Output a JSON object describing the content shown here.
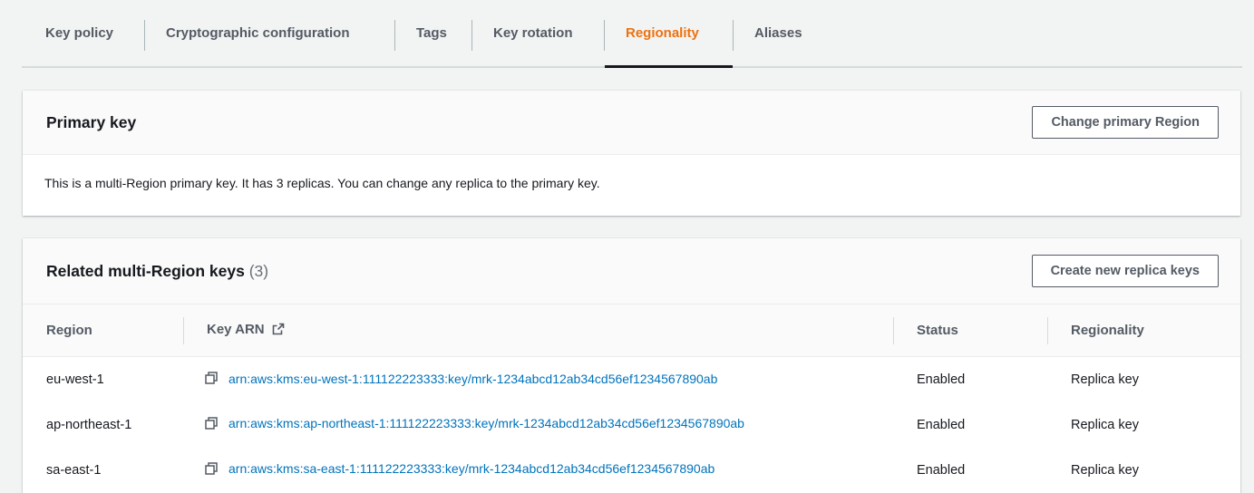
{
  "tabs": [
    {
      "label": "Key policy",
      "active": false
    },
    {
      "label": "Cryptographic configuration",
      "active": false
    },
    {
      "label": "Tags",
      "active": false
    },
    {
      "label": "Key rotation",
      "active": false
    },
    {
      "label": "Regionality",
      "active": true
    },
    {
      "label": "Aliases",
      "active": false
    }
  ],
  "primary_key": {
    "title": "Primary key",
    "button_label": "Change primary Region",
    "description": "This is a multi-Region primary key. It has 3 replicas. You can change any replica to the primary key."
  },
  "related_keys": {
    "title": "Related multi-Region keys",
    "count": "(3)",
    "button_label": "Create new replica keys",
    "columns": {
      "region": "Region",
      "key_arn": "Key ARN",
      "status": "Status",
      "regionality": "Regionality"
    },
    "rows": [
      {
        "region": "eu-west-1",
        "arn": "arn:aws:kms:eu-west-1:111122223333:key/mrk-1234abcd12ab34cd56ef1234567890ab",
        "status": "Enabled",
        "regionality": "Replica key"
      },
      {
        "region": "ap-northeast-1",
        "arn": "arn:aws:kms:ap-northeast-1:111122223333:key/mrk-1234abcd12ab34cd56ef1234567890ab",
        "status": "Enabled",
        "regionality": "Replica key"
      },
      {
        "region": "sa-east-1",
        "arn": "arn:aws:kms:sa-east-1:111122223333:key/mrk-1234abcd12ab34cd56ef1234567890ab",
        "status": "Enabled",
        "regionality": "Replica key"
      }
    ]
  },
  "colors": {
    "active_tab": "#ec7211",
    "link": "#0073bb",
    "text": "#16191f",
    "muted": "#545b64"
  },
  "icons": {
    "copy": "copy-icon",
    "external": "external-link-icon"
  }
}
